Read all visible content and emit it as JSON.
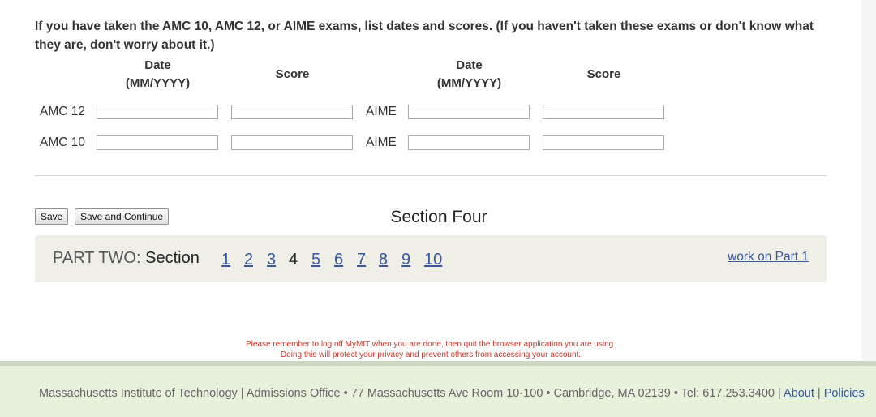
{
  "question": "If you have taken the AMC 10, AMC 12, or AIME exams, list dates and scores. (If you haven't taken these exams or don't know what they are, don't worry about it.)",
  "headers": {
    "date_line1": "Date",
    "date_line2": "(MM/YYYY)",
    "score": "Score"
  },
  "rows": [
    {
      "left_label": "AMC 12",
      "right_label": "AIME",
      "left_date": "",
      "left_score": "",
      "right_date": "",
      "right_score": ""
    },
    {
      "left_label": "AMC 10",
      "right_label": "AIME",
      "left_date": "",
      "left_score": "",
      "right_date": "",
      "right_score": ""
    }
  ],
  "buttons": {
    "save": "Save",
    "save_continue": "Save and Continue"
  },
  "section_title": "Section Four",
  "nav": {
    "part_label": "PART TWO:",
    "section_label": "Section",
    "current": "4",
    "sections": [
      "1",
      "2",
      "3",
      "4",
      "5",
      "6",
      "7",
      "8",
      "9",
      "10"
    ],
    "part1_link": "work on Part 1"
  },
  "notice": {
    "line1": "Please remember to log off MyMIT when you are done, then quit the browser application you are using.",
    "line2": "Doing this will protect your privacy and prevent others from accessing your account."
  },
  "footer": {
    "text": "Massachusetts Institute of Technology | Admissions Office • 77 Massachusetts Ave Room 10-100 • Cambridge, MA 02139 • Tel: 617.253.3400 | ",
    "about": "About",
    "separator": " | ",
    "policies": "Policies"
  },
  "colors": {
    "link": "#38579c",
    "notice": "#c0392b",
    "footer_bg": "#e7f1dc",
    "nav_bg": "#efefe8"
  }
}
